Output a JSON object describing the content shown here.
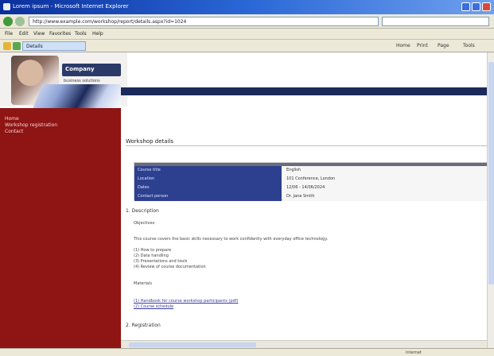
{
  "window": {
    "title": "Lorem ipsum - Microsoft Internet Explorer"
  },
  "address": {
    "url": "http://www.example.com/workshop/report/details.aspx?id=1024",
    "go_label": ""
  },
  "menu": {
    "items": [
      "File",
      "Edit",
      "View",
      "Favorites",
      "Tools",
      "Help"
    ]
  },
  "toolbar": {
    "tab_label": "Details",
    "right_items": [
      "Home",
      "Print",
      "Page",
      "Tools"
    ]
  },
  "site": {
    "brand": "Company",
    "tagline": "business solutions"
  },
  "sidebar": {
    "links": [
      "Home",
      "Workshop registration",
      "Contact"
    ]
  },
  "page": {
    "heading": "Workshop details",
    "info_rows": [
      {
        "key": "Course title",
        "value": "English"
      },
      {
        "key": "Location",
        "value": "101 Conference, London"
      },
      {
        "key": "Dates",
        "value": "12/06 - 14/06/2024"
      },
      {
        "key": "Contact person",
        "value": "Dr. Jane Smith"
      }
    ],
    "section1": "1. Description",
    "sub1": "Objectives",
    "para1": "This course covers the basic skills necessary to work confidently with everyday office technology.",
    "bullets": [
      "(1) How to prepare",
      "(2) Data handling",
      "(3) Presentations and tools",
      "(4) Review of course documentation"
    ],
    "sub2": "Materials",
    "links": [
      "(1) Handbook for course workshop participants (pdf)",
      "(2) Course schedule"
    ],
    "section2": "2. Registration"
  },
  "status": {
    "text": "Internet"
  }
}
